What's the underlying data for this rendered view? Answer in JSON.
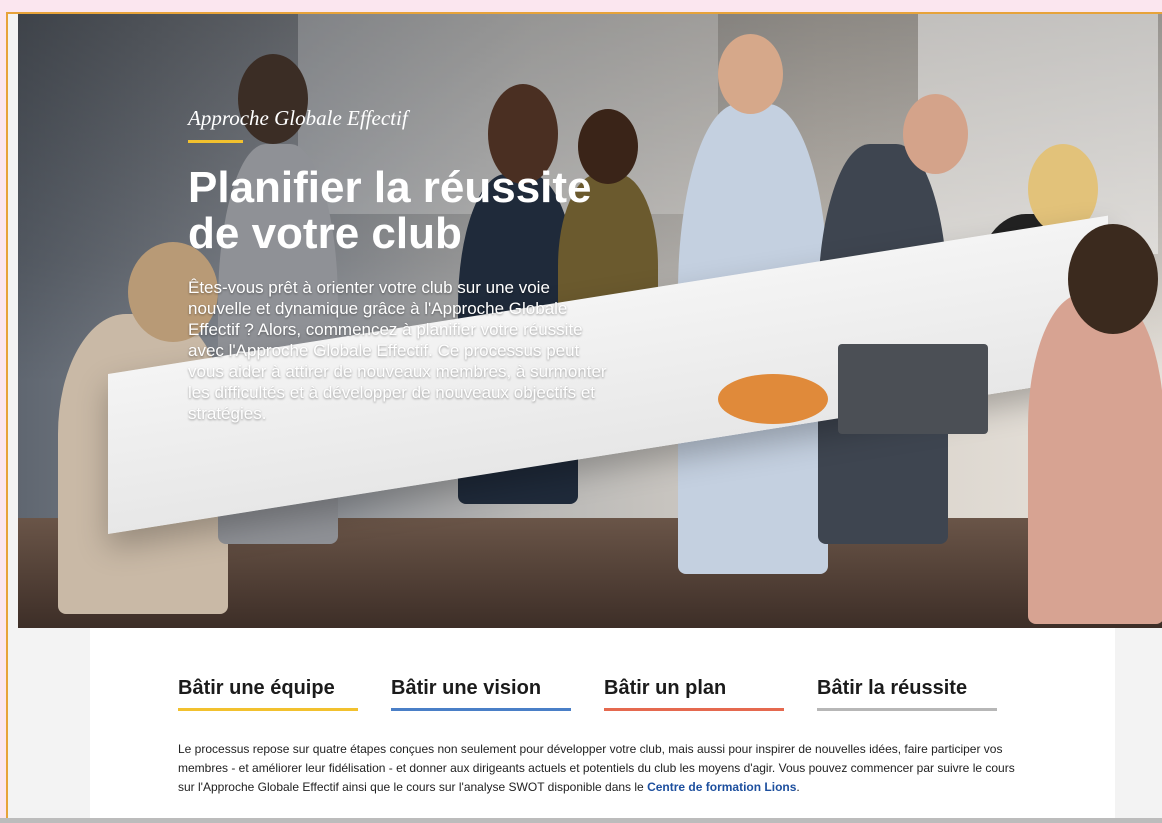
{
  "hero": {
    "eyebrow": "Approche Globale Effectif",
    "title": "Planifier la réussite de votre club",
    "description": "Êtes-vous prêt à orienter votre club sur une voie nouvelle et dynamique grâce à l'Approche Globale Effectif ? Alors, commencez à planifier votre réussite avec l'Approche Globale Effectif. Ce processus peut vous aider à attirer de nouveaux membres, à surmonter les difficultés et à développer de nouveaux objectifs et stratégies.",
    "accent_color": "#f2c12e"
  },
  "tabs": [
    {
      "label": "Bâtir une équipe",
      "color": "#f2c12e"
    },
    {
      "label": "Bâtir une vision",
      "color": "#4a7fc7"
    },
    {
      "label": "Bâtir un plan",
      "color": "#e5694f"
    },
    {
      "label": "Bâtir la réussite",
      "color": "#b7b7b7"
    }
  ],
  "body": {
    "text": "Le processus repose sur quatre étapes conçues non seulement pour développer votre club, mais aussi pour inspirer de nouvelles idées, faire participer vos membres - et améliorer leur fidélisation - et donner aux dirigeants actuels et potentiels du club les moyens d'agir. Vous pouvez commencer par suivre le cours sur l'Approche Globale Effectif ainsi que le cours sur l'analyse SWOT disponible dans le ",
    "link_text": "Centre de formation Lions",
    "suffix": ".",
    "link_color": "#1d4f9e"
  }
}
